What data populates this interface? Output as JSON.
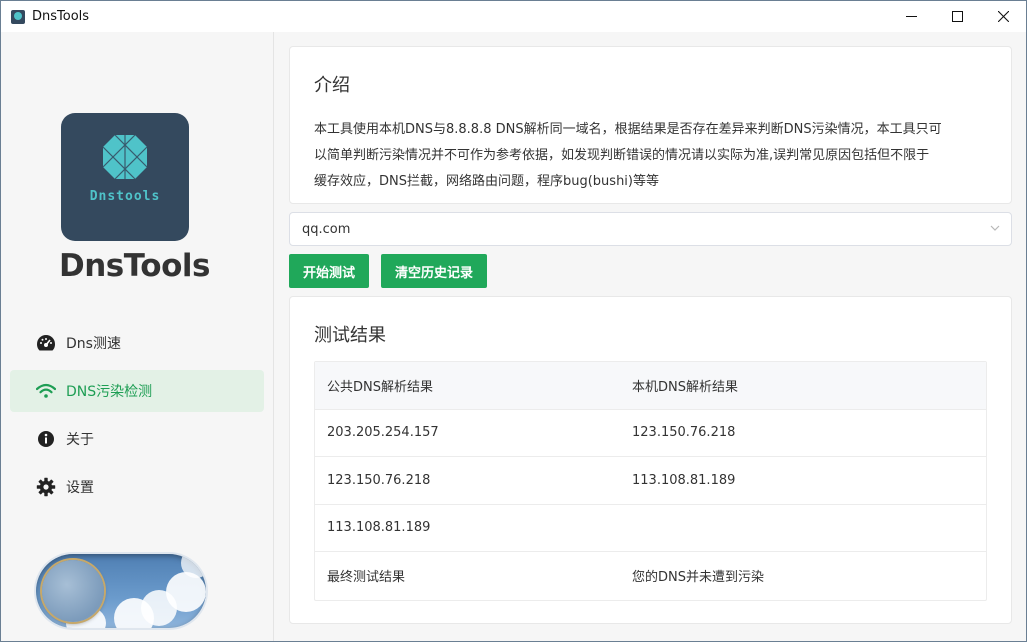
{
  "window": {
    "title": "DnsTools",
    "controls": [
      "minimize-icon",
      "maximize-icon",
      "close-icon"
    ]
  },
  "sidebar": {
    "logo_text": "Dnstools",
    "brand": "DnsTools",
    "items": [
      {
        "label": "Dns测速",
        "icon": "speedometer-icon",
        "active": false
      },
      {
        "label": "DNS污染检测",
        "icon": "wifi-icon",
        "active": true
      },
      {
        "label": "关于",
        "icon": "info-icon",
        "active": false
      },
      {
        "label": "设置",
        "icon": "gear-icon",
        "active": false
      }
    ],
    "theme_toggle": {
      "state": "light"
    }
  },
  "intro": {
    "title": "介绍",
    "line1": "本工具使用本机DNS与8.8.8.8 DNS解析同一域名，根据结果是否存在差异来判断DNS污染情况，本工具只可",
    "line2": "以简单判断污染情况并不可作为参考依据，如发现判断错误的情况请以实际为准,误判常见原因包括但不限于",
    "line3": "缓存效应，DNS拦截，网络路由问题，程序bug(bushi)等等"
  },
  "domain_select": {
    "value": "qq.com"
  },
  "buttons": {
    "start": "开始测试",
    "clear": "清空历史记录"
  },
  "results": {
    "title": "测试结果",
    "columns": [
      "公共DNS解析结果",
      "本机DNS解析结果"
    ],
    "rows": [
      [
        "203.205.254.157",
        "123.150.76.218"
      ],
      [
        "123.150.76.218",
        "113.108.81.189"
      ],
      [
        "113.108.81.189",
        ""
      ],
      [
        "最终测试结果",
        "您的DNS并未遭到污染"
      ]
    ]
  },
  "colors": {
    "accent": "#20a85a",
    "active_bg": "#e3f1e6",
    "logo_bg": "#34495e",
    "logo_fg": "#4fc3c9"
  }
}
